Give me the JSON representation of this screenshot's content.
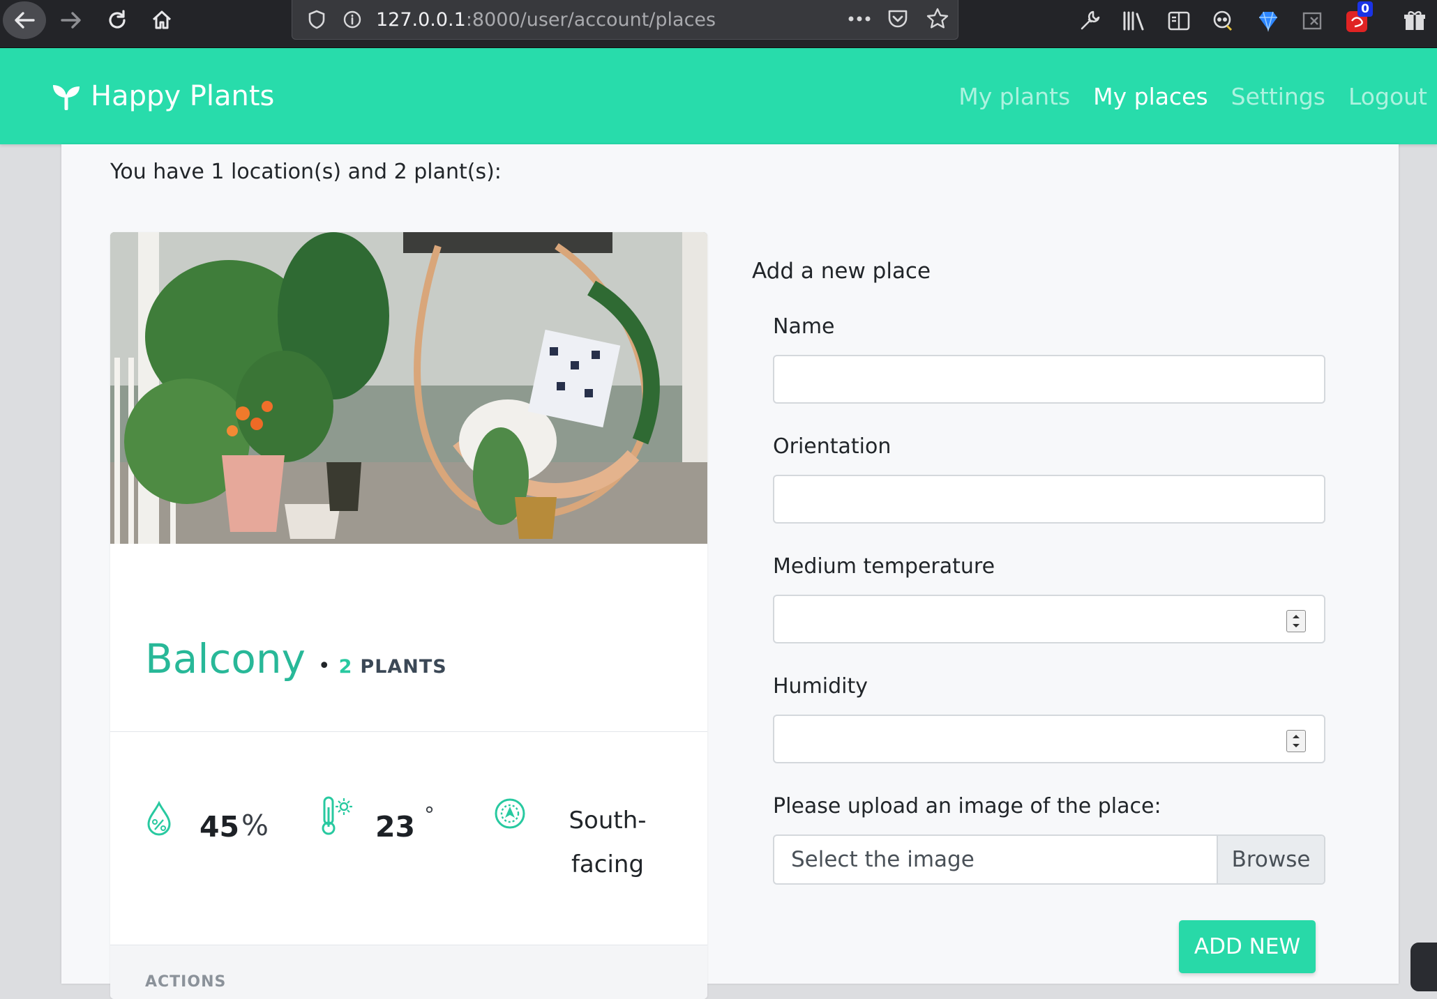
{
  "browser": {
    "url_host": "127.0.0.1",
    "url_path": ":8000/user/account/places",
    "badge_count": "0"
  },
  "navbar": {
    "brand": "Happy Plants",
    "links": [
      "My plants",
      "My places",
      "Settings",
      "Logout"
    ],
    "active": "My places",
    "accent_color": "#28dcab"
  },
  "summary": "You have 1 location(s) and 2 plant(s):",
  "card": {
    "place_name": "Balcony",
    "separator": "•",
    "plant_count": "2",
    "plants_label": "PLANTS",
    "humidity_value": "45",
    "humidity_unit": "%",
    "temperature_value": "23",
    "temperature_unit": "°",
    "orientation_line1": "South-",
    "orientation_line2": "facing",
    "actions_label": "ACTIONS",
    "icons": [
      "humidity-icon",
      "thermometer-icon",
      "compass-icon"
    ]
  },
  "form": {
    "title": "Add a new place",
    "name_label": "Name",
    "name_value": "",
    "orientation_label": "Orientation",
    "orientation_value": "",
    "temperature_label": "Medium temperature",
    "temperature_value": "",
    "humidity_label": "Humidity",
    "humidity_value": "",
    "upload_label": "Please upload an image of the place:",
    "upload_placeholder": "Select the image",
    "browse_label": "Browse",
    "submit_label": "ADD NEW"
  }
}
